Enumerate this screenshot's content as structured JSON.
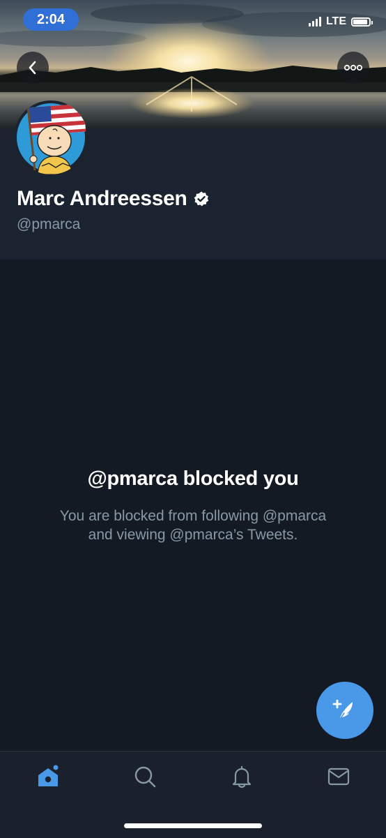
{
  "status_bar": {
    "time": "2:04",
    "network": "LTE"
  },
  "profile": {
    "name": "Marc Andreessen",
    "handle": "@pmarca",
    "verified": true
  },
  "icons": {
    "back": "chevron-left-icon",
    "more": "more-options-icon",
    "verified": "verified-badge-icon",
    "compose": "compose-tweet-icon"
  },
  "blocked": {
    "title": "@pmarca blocked you",
    "message": "You are blocked from following @pmarca and viewing @pmarca’s Tweets."
  },
  "tab_bar": {
    "tabs": [
      {
        "name": "home",
        "icon": "home-icon",
        "active": true
      },
      {
        "name": "search",
        "icon": "search-icon",
        "active": false
      },
      {
        "name": "notifications",
        "icon": "bell-icon",
        "active": false
      },
      {
        "name": "messages",
        "icon": "mail-icon",
        "active": false
      }
    ]
  },
  "colors": {
    "accent": "#4a99e9",
    "background": "#131a23",
    "header_panel": "#1b2330",
    "secondary_text": "#8899a6"
  }
}
